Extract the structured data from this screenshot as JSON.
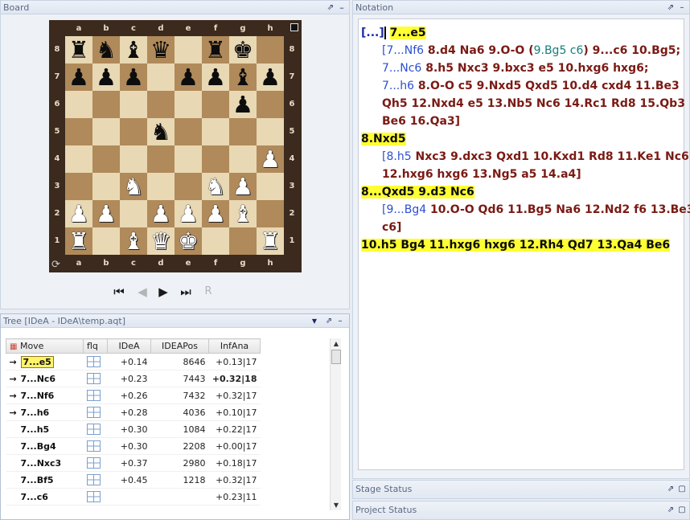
{
  "board_panel": {
    "title": "Board"
  },
  "board": {
    "files": [
      "a",
      "b",
      "c",
      "d",
      "e",
      "f",
      "g",
      "h"
    ],
    "ranks": [
      "8",
      "7",
      "6",
      "5",
      "4",
      "3",
      "2",
      "1"
    ],
    "rows": [
      [
        "bR",
        "bN",
        "bB",
        "bQ",
        "",
        "bR",
        "bK",
        ""
      ],
      [
        "bP",
        "bP",
        "bP",
        "",
        "bP",
        "bP",
        "bB",
        "bP"
      ],
      [
        "",
        "",
        "",
        "",
        "",
        "",
        "bP",
        ""
      ],
      [
        "",
        "",
        "",
        "bN",
        "",
        "",
        "",
        ""
      ],
      [
        "",
        "",
        "",
        "",
        "",
        "",
        "",
        "wP"
      ],
      [
        "",
        "",
        "wN",
        "",
        "",
        "wN",
        "wP",
        ""
      ],
      [
        "wP",
        "wP",
        "",
        "wP",
        "wP",
        "wP",
        "wB",
        ""
      ],
      [
        "wR",
        "",
        "wB",
        "wQ",
        "wK",
        "",
        "",
        "wR"
      ]
    ],
    "glyphs": {
      "K": "♚",
      "Q": "♛",
      "R": "♜",
      "B": "♝",
      "N": "♞",
      "P": "♟"
    },
    "nav": {
      "first": "⏮",
      "prev": "◀",
      "next": "▶",
      "last": "⏭",
      "r": "R"
    }
  },
  "tree_panel": {
    "title": "Tree [IDeA - IDeA\\temp.aqt]",
    "columns": [
      "Move",
      "flq",
      "IDeA",
      "IDEAPos",
      "InfAna"
    ],
    "rows": [
      {
        "arrow": "→",
        "move": "7...e5",
        "ideа": "+0.14",
        "pos": "8646",
        "ana": "+0.13|17",
        "bold_ana": false,
        "selected": true
      },
      {
        "arrow": "→",
        "move": "7...Nc6",
        "ideа": "+0.23",
        "pos": "7443",
        "ana": "+0.32|18",
        "bold_ana": true,
        "selected": false
      },
      {
        "arrow": "→",
        "move": "7...Nf6",
        "ideа": "+0.26",
        "pos": "7432",
        "ana": "+0.32|17",
        "bold_ana": false,
        "selected": false
      },
      {
        "arrow": "→",
        "move": "7...h6",
        "ideа": "+0.28",
        "pos": "4036",
        "ana": "+0.10|17",
        "bold_ana": false,
        "selected": false
      },
      {
        "arrow": "",
        "move": "7...h5",
        "ideа": "+0.30",
        "pos": "1084",
        "ana": "+0.22|17",
        "bold_ana": false,
        "selected": false
      },
      {
        "arrow": "",
        "move": "7...Bg4",
        "ideа": "+0.30",
        "pos": "2208",
        "ana": "+0.00|17",
        "bold_ana": false,
        "selected": false
      },
      {
        "arrow": "",
        "move": "7...Nxc3",
        "ideа": "+0.37",
        "pos": "2980",
        "ana": "+0.18|17",
        "bold_ana": false,
        "selected": false
      },
      {
        "arrow": "",
        "move": "7...Bf5",
        "ideа": "+0.45",
        "pos": "1218",
        "ana": "+0.32|17",
        "bold_ana": false,
        "selected": false
      },
      {
        "arrow": "",
        "move": "7...c6",
        "ideа": "",
        "pos": "",
        "ana": "+0.23|11",
        "bold_ana": false,
        "selected": false
      }
    ]
  },
  "notation_panel": {
    "title": "Notation",
    "l1_bracket": "[...]",
    "l1_move": "7...e5",
    "l2_intro": "[7...Nf6",
    "l2_a": " 8.d4 Na6 9.O-O (",
    "l2_sub": "9.Bg5 c6",
    "l2_b": ") 9...c6 10.Bg5;",
    "l3_intro": "7...Nc6",
    "l3_a": " 8.h5 Nxc3 9.bxc3 e5 10.hxg6 hxg6;",
    "l4_intro": "7...h6",
    "l4_a": " 8.O-O c5 9.Nxd5 Qxd5 10.d4 cxd4 11.Be3",
    "l5": "Qh5 12.Nxd4 e5 13.Nb5 Nc6 14.Rc1 Rd8 15.Qb3",
    "l6": "Be6 16.Qa3]",
    "l7_move": "8.Nxd5",
    "l8_intro": "[8.h5",
    "l8_a": " Nxc3 9.dxc3 Qxd1 10.Kxd1 Rd8 11.Ke1 Nc6",
    "l9": "12.hxg6 hxg6 13.Ng5 a5 14.a4]",
    "l10_move": "8...Qxd5 9.d3 Nc6",
    "l11_intro": "[9...Bg4",
    "l11_a": " 10.O-O Qd6 11.Bg5 Na6 12.Nd2 f6 13.Be3",
    "l12": "c6]",
    "l13_move": "10.h5 Bg4 11.hxg6 hxg6 12.Rh4 Qd7 13.Qa4 Be6"
  },
  "stage_status": {
    "title": "Stage Status"
  },
  "project_status": {
    "title": "Project Status"
  },
  "icons": {
    "pin": "⇗",
    "close": "✕",
    "dropdown": "▼",
    "restore": "▢",
    "flip": "⟳"
  }
}
